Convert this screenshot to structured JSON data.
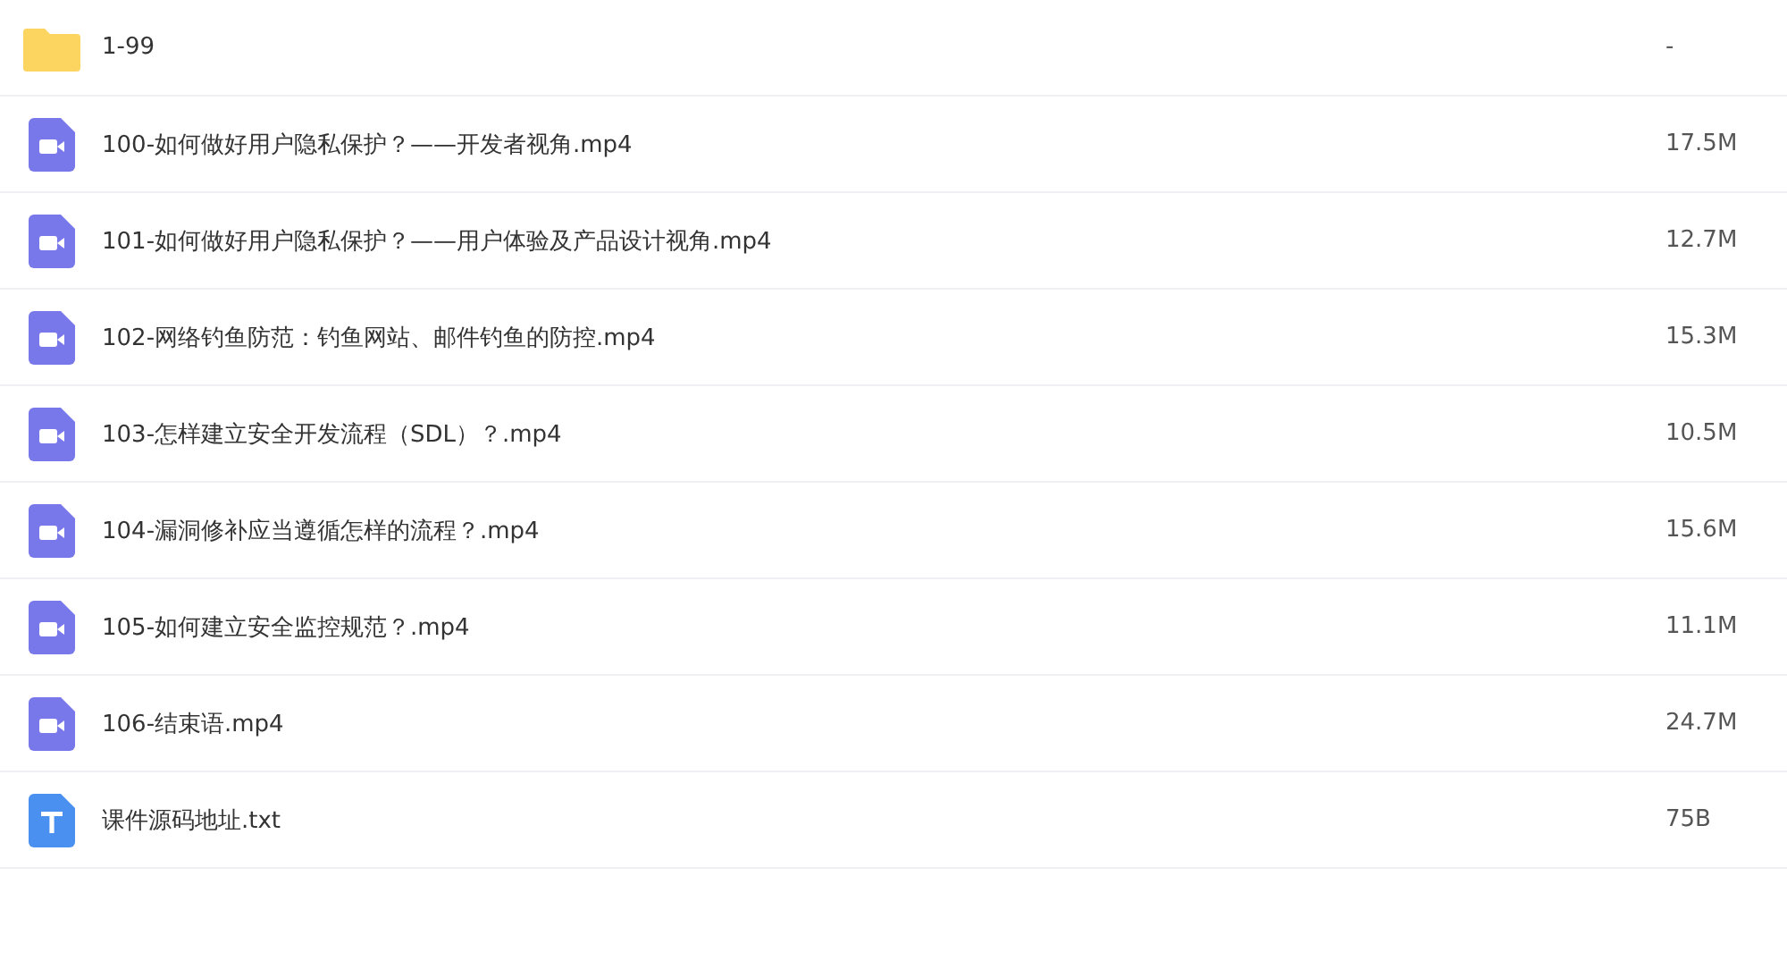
{
  "files": [
    {
      "kind": "folder",
      "name": "1-99",
      "size": "-"
    },
    {
      "kind": "video",
      "name": "100-如何做好用户隐私保护？——开发者视角.mp4",
      "size": "17.5M"
    },
    {
      "kind": "video",
      "name": "101-如何做好用户隐私保护？——用户体验及产品设计视角.mp4",
      "size": "12.7M"
    },
    {
      "kind": "video",
      "name": "102-网络钓鱼防范：钓鱼网站、邮件钓鱼的防控.mp4",
      "size": "15.3M"
    },
    {
      "kind": "video",
      "name": "103-怎样建立安全开发流程（SDL）？.mp4",
      "size": "10.5M"
    },
    {
      "kind": "video",
      "name": "104-漏洞修补应当遵循怎样的流程？.mp4",
      "size": "15.6M"
    },
    {
      "kind": "video",
      "name": "105-如何建立安全监控规范？.mp4",
      "size": "11.1M"
    },
    {
      "kind": "video",
      "name": "106-结束语.mp4",
      "size": "24.7M"
    },
    {
      "kind": "text",
      "name": "课件源码地址.txt",
      "size": "75B"
    }
  ]
}
